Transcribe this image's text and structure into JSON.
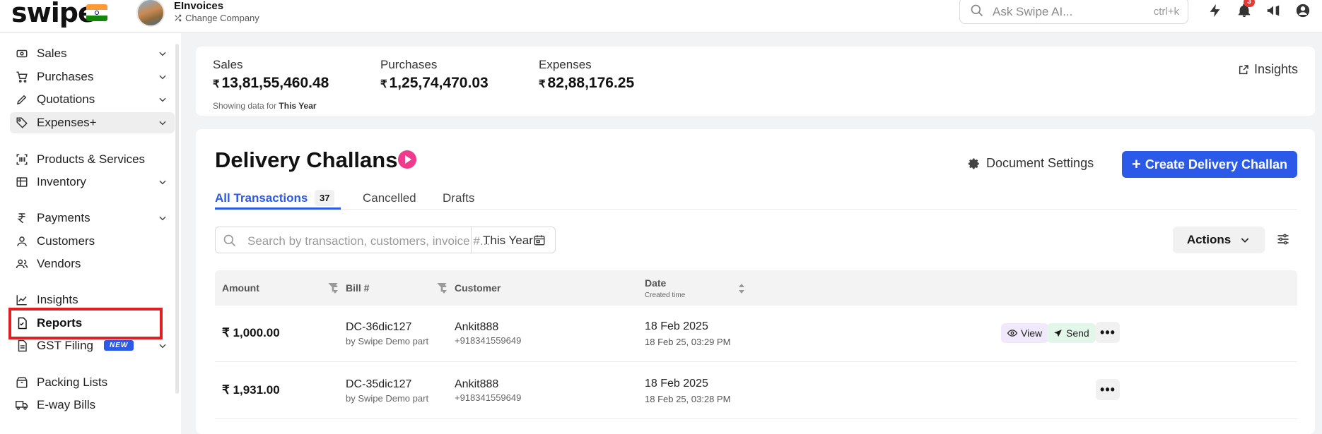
{
  "topbar": {
    "logo": "swipe",
    "company_name": "EInvoices",
    "change_company": "Change Company",
    "search_placeholder": "Ask Swipe AI...",
    "search_shortcut": "ctrl+k",
    "notification_count": "3"
  },
  "sidebar": {
    "items": [
      {
        "label": "Sales",
        "icon": "sales-icon"
      },
      {
        "label": "Purchases",
        "icon": "cart-icon"
      },
      {
        "label": "Quotations",
        "icon": "pencil-icon"
      },
      {
        "label": "Expenses+",
        "icon": "tag-icon"
      },
      {
        "label": "Products & Services",
        "icon": "barcode-icon"
      },
      {
        "label": "Inventory",
        "icon": "inventory-icon"
      },
      {
        "label": "Payments",
        "icon": "rupee-icon"
      },
      {
        "label": "Customers",
        "icon": "user-icon"
      },
      {
        "label": "Vendors",
        "icon": "users-icon"
      },
      {
        "label": "Insights",
        "icon": "chart-icon"
      },
      {
        "label": "Reports",
        "icon": "report-icon"
      },
      {
        "label": "GST Filing",
        "icon": "document-icon",
        "tag": "NEW"
      },
      {
        "label": "Packing Lists",
        "icon": "box-icon"
      },
      {
        "label": "E-way Bills",
        "icon": "truck-icon"
      }
    ]
  },
  "stats": {
    "sales_label": "Sales",
    "sales_value": "13,81,55,460.48",
    "purchases_label": "Purchases",
    "purchases_value": "1,25,74,470.03",
    "expenses_label": "Expenses",
    "expenses_value": "82,88,176.25",
    "currency": "₹",
    "showing_prefix": "Showing data for",
    "showing_period": "This Year",
    "insights_label": "Insights"
  },
  "main": {
    "title": "Delivery Challans",
    "document_settings": "Document Settings",
    "create_button": "Create Delivery Challan",
    "tabs": [
      {
        "label": "All Transactions",
        "count": "37"
      },
      {
        "label": "Cancelled"
      },
      {
        "label": "Drafts"
      }
    ],
    "search_placeholder": "Search by transaction, customers, invoice #...",
    "period": "This Year",
    "actions_label": "Actions",
    "columns": {
      "amount": "Amount",
      "bill": "Bill #",
      "customer": "Customer",
      "date": "Date",
      "date_sub": "Created time"
    },
    "rows": [
      {
        "amount": "₹ 1,000.00",
        "bill": "DC-36dic127",
        "bill_sub": "by Swipe Demo part",
        "customer": "Ankit888",
        "phone": "+918341559649",
        "date": "18 Feb 2025",
        "created": "18 Feb 25, 03:29 PM",
        "view_label": "View",
        "send_label": "Send"
      },
      {
        "amount": "₹ 1,931.00",
        "bill": "DC-35dic127",
        "bill_sub": "by Swipe Demo part",
        "customer": "Ankit888",
        "phone": "+918341559649",
        "date": "18 Feb 2025",
        "created": "18 Feb 25, 03:28 PM"
      }
    ]
  },
  "colors": {
    "primary": "#2b59e8",
    "highlight": "#e02020",
    "play": "#ef3b8c"
  }
}
